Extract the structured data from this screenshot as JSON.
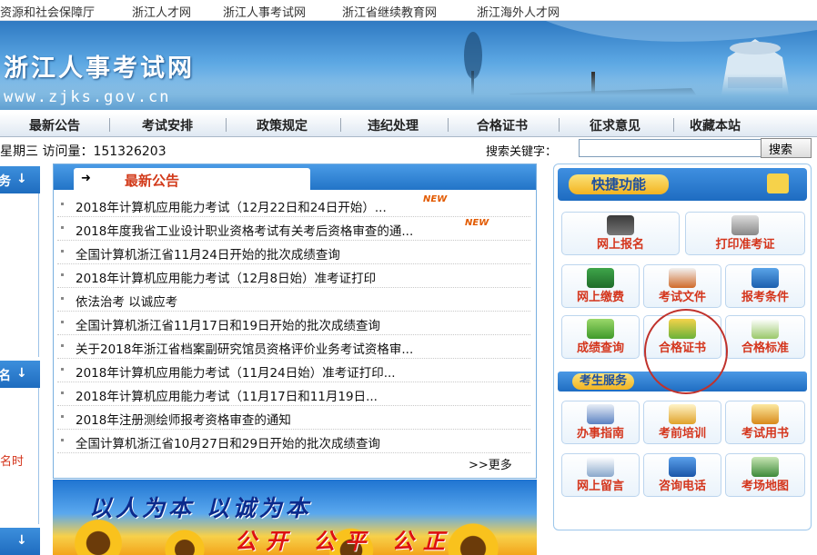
{
  "top_links": [
    "资源和社会保障厅",
    "浙江人才网",
    "浙江人事考试网",
    "浙江省继续教育网",
    "浙江海外人才网"
  ],
  "banner": {
    "title": "浙江人事考试网",
    "url": "www.zjks.gov.cn"
  },
  "nav": [
    "最新公告",
    "考试安排",
    "政策规定",
    "违纪处理",
    "合格证书",
    "征求意见",
    "收藏本站"
  ],
  "status": {
    "visit_text": "星期三 访问量：151326203",
    "search_label": "搜索关键字：",
    "search_value": "",
    "search_button": "搜索"
  },
  "left": {
    "tab1": "务",
    "tab2": "名",
    "note": "名时"
  },
  "announcements": {
    "title": "最新公告",
    "items": [
      {
        "text": "2018年计算机应用能力考试（12月22日和24日开始）...",
        "is_new": true
      },
      {
        "text": "2018年度我省工业设计职业资格考试有关考后资格审查的通...",
        "is_new": true
      },
      {
        "text": "全国计算机浙江省11月24日开始的批次成绩查询",
        "is_new": false
      },
      {
        "text": "2018年计算机应用能力考试（12月8日始）准考证打印",
        "is_new": false
      },
      {
        "text": "依法治考 以诚应考",
        "is_new": false
      },
      {
        "text": "全国计算机浙江省11月17日和19日开始的批次成绩查询",
        "is_new": false
      },
      {
        "text": "关于2018年浙江省档案副研究馆员资格评价业务考试资格审...",
        "is_new": false
      },
      {
        "text": "2018年计算机应用能力考试（11月24日始）准考证打印...",
        "is_new": false
      },
      {
        "text": "2018年计算机应用能力考试（11月17日和11月19日...",
        "is_new": false
      },
      {
        "text": "2018年注册测绘师报考资格审查的通知",
        "is_new": false
      },
      {
        "text": "全国计算机浙江省10月27日和29日开始的批次成绩查询",
        "is_new": false
      }
    ],
    "more": ">>更多",
    "new_badge": "NEW"
  },
  "poster": {
    "line1": "以人为本 以诚为本",
    "line2": "公开 公平 公正"
  },
  "quick": {
    "title": "快捷功能",
    "tiles_top": [
      "网上报名",
      "打印准考证"
    ],
    "tiles_grid": [
      "网上缴费",
      "考试文件",
      "报考条件",
      "成绩查询",
      "合格证书",
      "合格标准"
    ],
    "service_title": "考生服务",
    "service_tiles": [
      "办事指南",
      "考前培训",
      "考试用书",
      "网上留言",
      "咨询电话",
      "考场地图"
    ]
  }
}
